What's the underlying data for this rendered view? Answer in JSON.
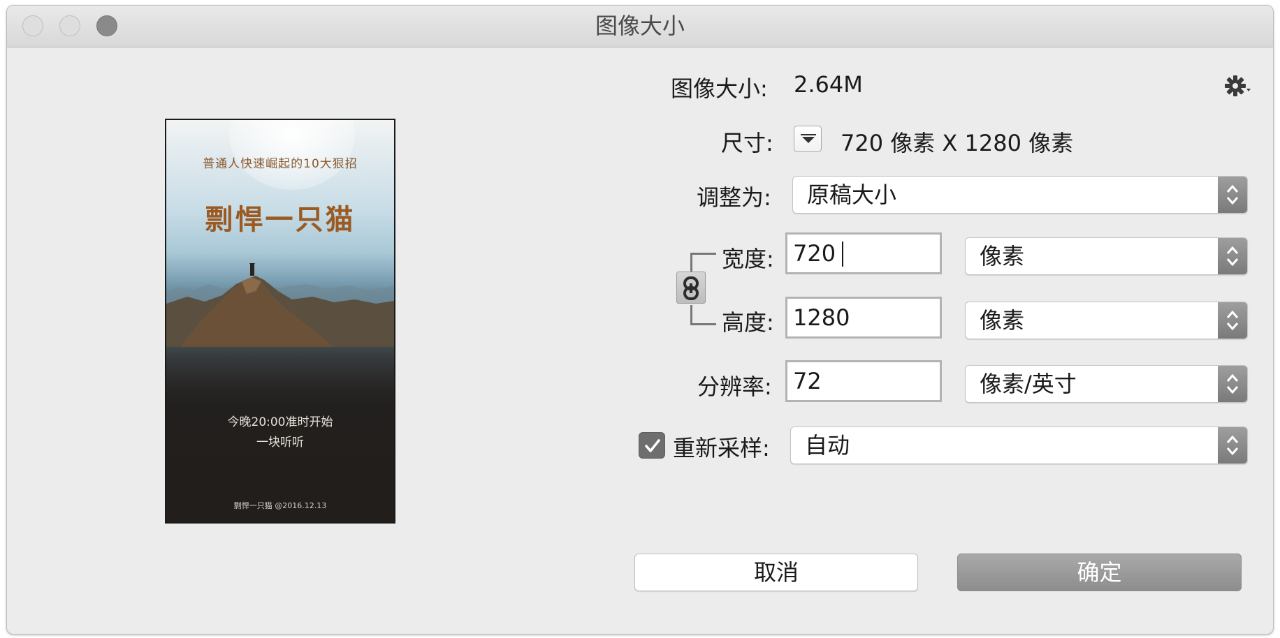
{
  "window": {
    "title": "图像大小"
  },
  "preview": {
    "subtitle": "普通人快速崛起的10大狠招",
    "title": "剽悍一只猫",
    "time_line": "今晚20:00准时开始",
    "together_line": "一块听听",
    "footer": "剽悍一只猫 @2016.12.13"
  },
  "form": {
    "image_size_label": "图像大小:",
    "image_size_value": "2.64M",
    "dimensions_label": "尺寸:",
    "dimensions_value": "720 像素  X  1280 像素",
    "fit_to_label": "调整为:",
    "fit_to_value": "原稿大小",
    "width_label": "宽度:",
    "width_value": "720",
    "width_unit": "像素",
    "height_label": "高度:",
    "height_value": "1280",
    "height_unit": "像素",
    "resolution_label": "分辨率:",
    "resolution_value": "72",
    "resolution_unit": "像素/英寸",
    "resample_label": "重新采样:",
    "resample_checked": true,
    "resample_value": "自动"
  },
  "buttons": {
    "cancel": "取消",
    "ok": "确定"
  },
  "icons": {
    "gear": "gear-icon",
    "disclosure": "triangle-down-icon",
    "link": "chain-link-icon",
    "checkmark": "checkmark-icon",
    "select_arrows": "up-down-chevron-icon"
  },
  "colors": {
    "window_bg": "#ececec",
    "title_color": "#9a5a22",
    "subtitle_color": "#8a5a2e",
    "ok_button": "#9b9b9b"
  }
}
